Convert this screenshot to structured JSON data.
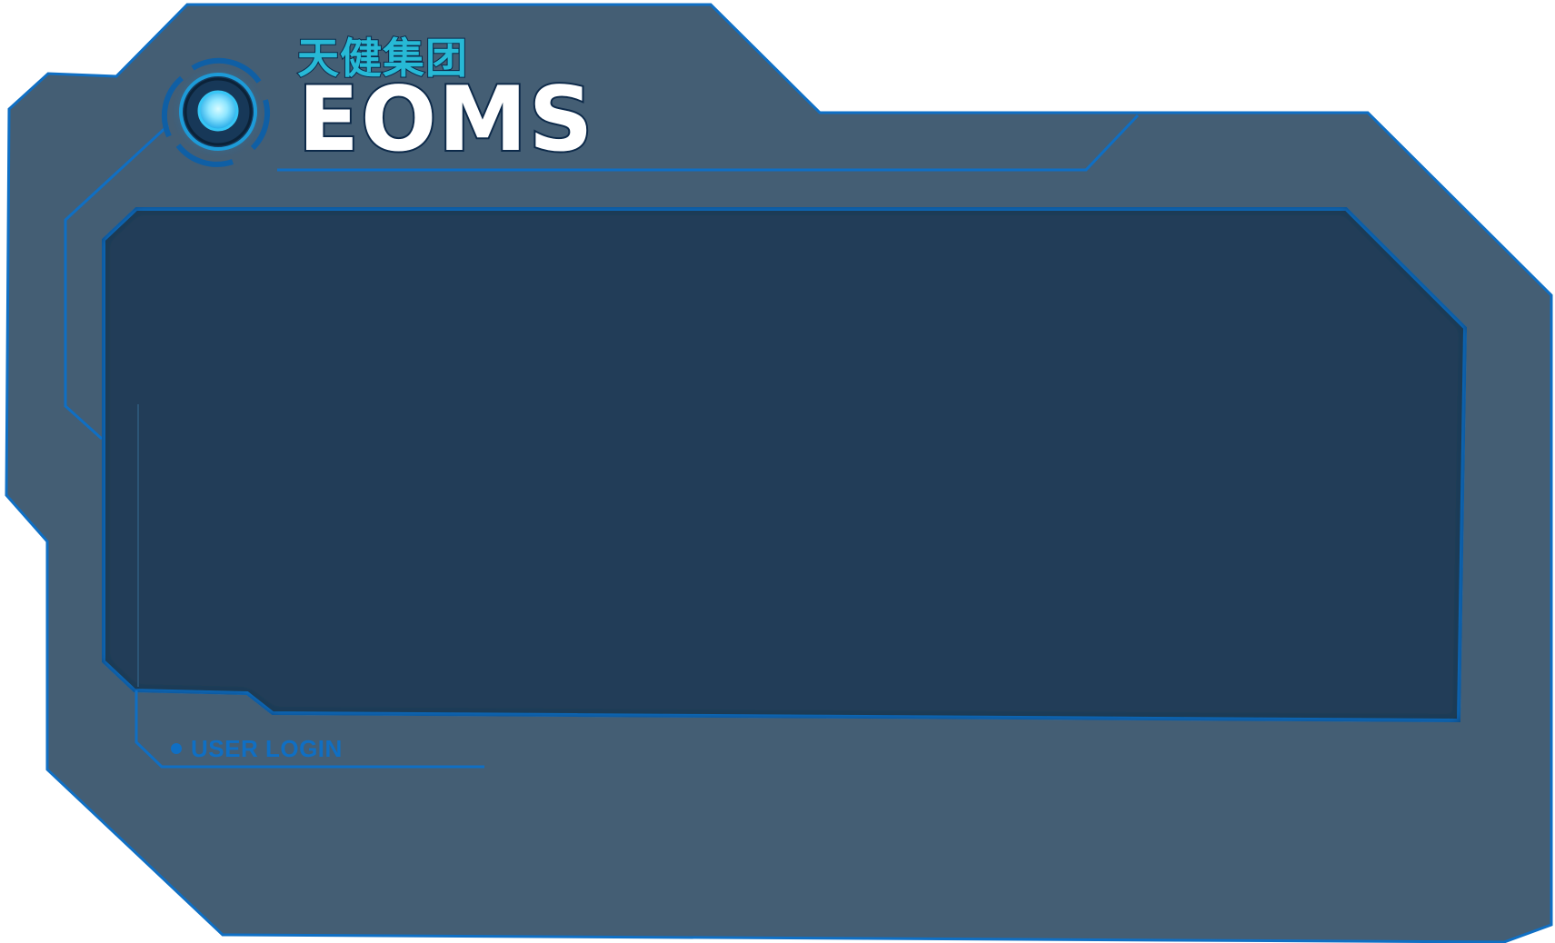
{
  "brand": {
    "cn_title": "天健集团",
    "en_title": "EOMS"
  },
  "login_panel": {
    "caption": "USER LOGIN"
  },
  "theme": {
    "outer_fill": "#445e74",
    "inner_fill": "#203e59",
    "accent_blue": "#0f6fc4",
    "outline_dark": "#12314f",
    "brand_cyan": "#27b9d6",
    "orb_glow": "#8fe6ff"
  },
  "icons": {
    "logo": "glowing-orb-icon",
    "caption_bullet": "dot-icon"
  }
}
